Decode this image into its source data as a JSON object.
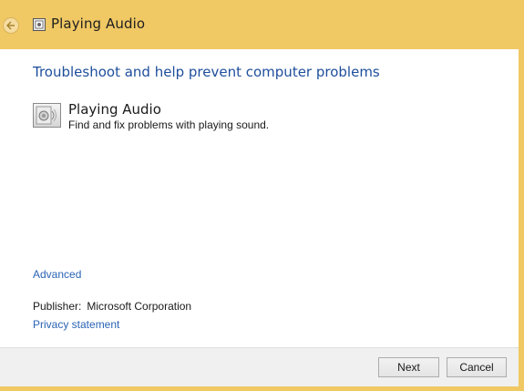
{
  "window": {
    "title": "Playing Audio"
  },
  "main": {
    "heading": "Troubleshoot and help prevent computer problems",
    "item": {
      "title": "Playing Audio",
      "description": "Find and fix problems with playing sound.",
      "icon": "speaker-icon"
    },
    "advanced_link": "Advanced",
    "publisher_label": "Publisher:",
    "publisher_value": "Microsoft Corporation",
    "privacy_link": "Privacy statement"
  },
  "footer": {
    "next_label": "Next",
    "cancel_label": "Cancel"
  },
  "colors": {
    "frame": "#f0c864",
    "link": "#2a64b4",
    "heading": "#1e4e9c"
  }
}
